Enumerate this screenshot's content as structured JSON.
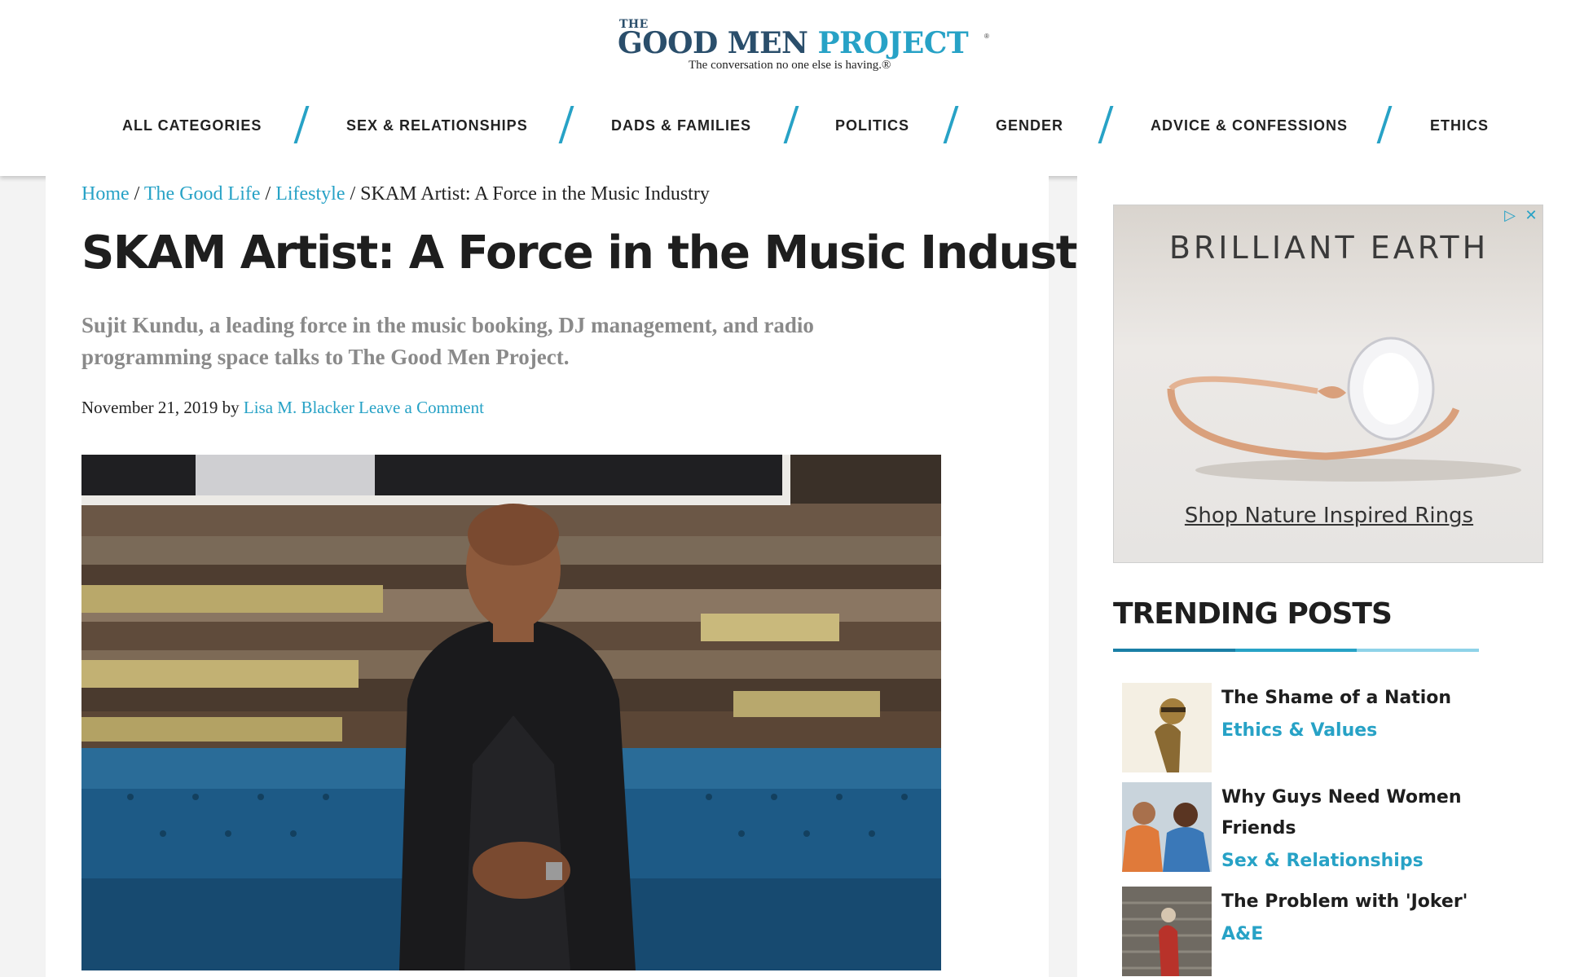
{
  "site": {
    "logo_the": "THE",
    "logo_good_men": "GOOD MEN ",
    "logo_project": "PROJECT",
    "logo_reg": "®",
    "tagline": "The conversation no one else is having.®"
  },
  "nav": {
    "items": [
      {
        "label": "ALL CATEGORIES"
      },
      {
        "label": "SEX & RELATIONSHIPS"
      },
      {
        "label": "DADS & FAMILIES"
      },
      {
        "label": "POLITICS"
      },
      {
        "label": "GENDER"
      },
      {
        "label": "ADVICE & CONFESSIONS"
      },
      {
        "label": "ETHICS"
      }
    ]
  },
  "breadcrumb": {
    "items": [
      {
        "label": "Home"
      },
      {
        "label": "The Good Life"
      },
      {
        "label": "Lifestyle"
      }
    ],
    "separator": " / ",
    "current": "SKAM Artist: A Force in the Music Industry"
  },
  "article": {
    "title": "SKAM Artist: A Force in the Music Industry",
    "subtitle": "Sujit Kundu, a leading force in the music booking, DJ management, and radio programming space talks to The Good Men Project.",
    "date": "November 21, 2019",
    "by": " by ",
    "author": "Lisa M. Blacker",
    "comment_link": "Leave a Comment"
  },
  "ad": {
    "brand": "BRILLIANT EARTH",
    "cta": "Shop Nature Inspired Rings",
    "icons": [
      "adchoices-icon",
      "close-icon"
    ]
  },
  "trending": {
    "title": "TRENDING POSTS",
    "bar_colors": [
      "#1a7fa6",
      "#27a2c6",
      "#8fd3e8"
    ],
    "posts": [
      {
        "title": "The Shame of a Nation",
        "category": "Ethics & Values"
      },
      {
        "title": "Why Guys Need Women Friends",
        "category": "Sex & Relationships"
      },
      {
        "title": "The Problem with 'Joker'",
        "category": "A&E"
      }
    ]
  },
  "colors": {
    "accent": "#27a2c6",
    "logo_dark": "#2a4e6b"
  }
}
